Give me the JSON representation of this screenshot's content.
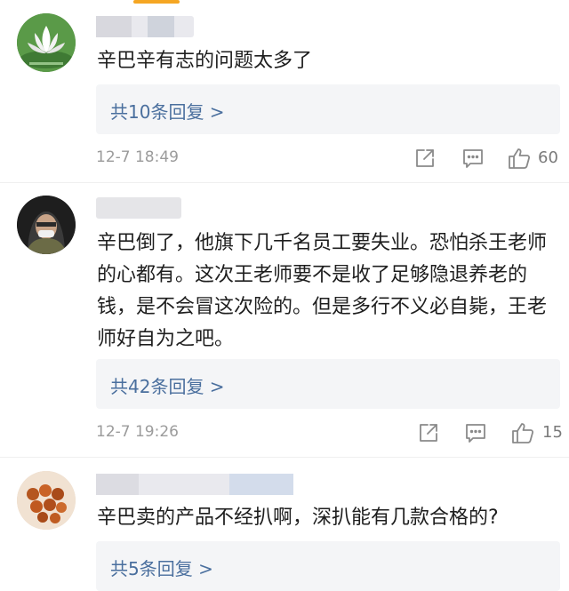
{
  "comments": [
    {
      "text": "辛巴辛有志的问题太多了",
      "reply_label": "共10条回复 >",
      "timestamp": "12-7 18:49",
      "likes": "60",
      "avatar": "lotus-avatar"
    },
    {
      "text": "辛巴倒了，他旗下几千名员工要失业。恐怕杀王老师的心都有。这次王老师要不是收了足够隐退养老的钱，是不会冒这次险的。但是多行不义必自毙，王老师好自为之吧。",
      "reply_label": "共42条回复 >",
      "timestamp": "12-7 19:26",
      "likes": "15",
      "avatar": "hooded-person-avatar"
    },
    {
      "text": "辛巴卖的产品不经扒啊，深扒能有几款合格的?",
      "reply_label": "共5条回复 >",
      "avatar": "fruit-avatar"
    }
  ],
  "icons": {
    "share": "share-icon",
    "comment": "comment-icon",
    "like": "thumbs-up-icon"
  },
  "colors": {
    "link": "#4a6f9e",
    "reply_bg": "#f4f5f7",
    "meta_text": "#9b9b9b",
    "tab_indicator": "#f5a623"
  }
}
